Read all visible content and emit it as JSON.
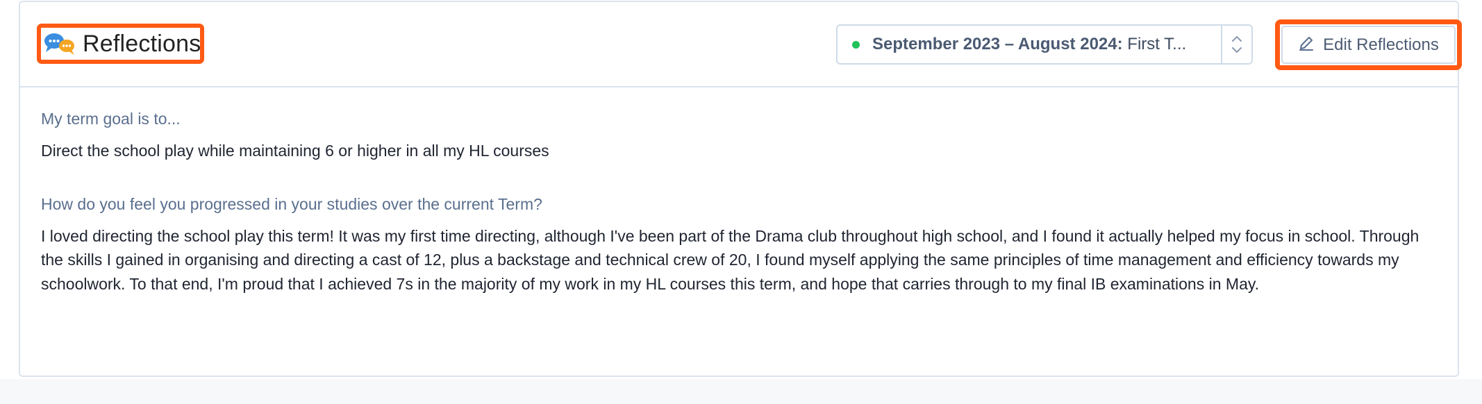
{
  "header": {
    "title": "Reflections",
    "title_icon": "speech-bubbles-icon",
    "term_selector": {
      "bold": "September 2023 – August 2024:",
      "rest": " First T...",
      "status_color": "#20c35a"
    },
    "edit_button": {
      "label": "Edit Reflections",
      "icon": "pencil-icon"
    }
  },
  "reflections": [
    {
      "question": "My term goal is to...",
      "answer": "Direct the school play while maintaining 6 or higher in all my HL courses"
    },
    {
      "question": "How do you feel you progressed in your studies over the current Term?",
      "answer": "I loved directing the school play this term! It was my first time directing, although I've been part of the Drama club throughout high school, and I found it actually helped my focus in school. Through the skills I gained in organising and directing a cast of 12, plus a backstage and technical crew of 20, I found myself applying the same principles of time management and efficiency towards my schoolwork. To that end, I'm proud that I achieved 7s in the majority of my work in my HL courses this term, and hope that carries through to my final IB examinations in May."
    }
  ],
  "colors": {
    "highlight": "#ff5a14",
    "border": "#dbe4ee",
    "question_text": "#5a6f8e"
  }
}
